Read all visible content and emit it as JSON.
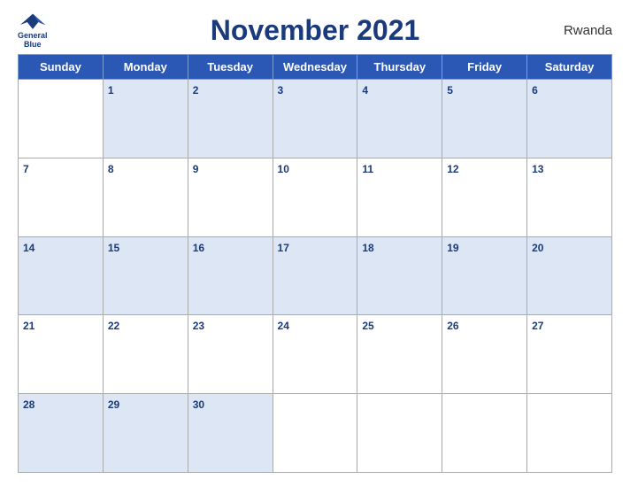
{
  "header": {
    "title": "November 2021",
    "country": "Rwanda",
    "logo_line1": "General",
    "logo_line2": "Blue"
  },
  "days_of_week": [
    "Sunday",
    "Monday",
    "Tuesday",
    "Wednesday",
    "Thursday",
    "Friday",
    "Saturday"
  ],
  "weeks": [
    [
      {
        "date": "",
        "outside": true
      },
      {
        "date": "1"
      },
      {
        "date": "2"
      },
      {
        "date": "3"
      },
      {
        "date": "4"
      },
      {
        "date": "5"
      },
      {
        "date": "6"
      }
    ],
    [
      {
        "date": "7"
      },
      {
        "date": "8"
      },
      {
        "date": "9"
      },
      {
        "date": "10"
      },
      {
        "date": "11"
      },
      {
        "date": "12"
      },
      {
        "date": "13"
      }
    ],
    [
      {
        "date": "14"
      },
      {
        "date": "15"
      },
      {
        "date": "16"
      },
      {
        "date": "17"
      },
      {
        "date": "18"
      },
      {
        "date": "19"
      },
      {
        "date": "20"
      }
    ],
    [
      {
        "date": "21"
      },
      {
        "date": "22"
      },
      {
        "date": "23"
      },
      {
        "date": "24"
      },
      {
        "date": "25"
      },
      {
        "date": "26"
      },
      {
        "date": "27"
      }
    ],
    [
      {
        "date": "28"
      },
      {
        "date": "29"
      },
      {
        "date": "30"
      },
      {
        "date": "",
        "outside": true
      },
      {
        "date": "",
        "outside": true
      },
      {
        "date": "",
        "outside": true
      },
      {
        "date": "",
        "outside": true
      }
    ]
  ]
}
